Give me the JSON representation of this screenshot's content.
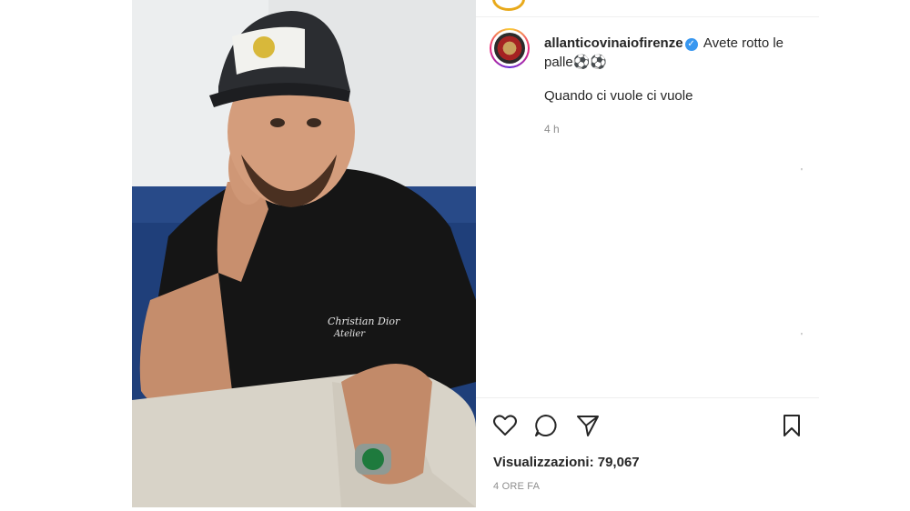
{
  "post": {
    "username": "allanticovinaiofirenze",
    "caption_text": "Avete rotto le palle⚽⚽",
    "comment_text": "Quando ci vuole ci vuole",
    "comment_time": "4 h",
    "views_label": "Visualizzazioni: 79,067",
    "time_ago": "4 ORE FA"
  },
  "icons": {
    "verified": "verified-badge-icon",
    "like": "heart-icon",
    "comment": "comment-icon",
    "share": "send-icon",
    "save": "bookmark-icon"
  },
  "colors": {
    "verified_blue": "#3897f0",
    "text": "#262626",
    "muted": "#8e8e8e"
  }
}
